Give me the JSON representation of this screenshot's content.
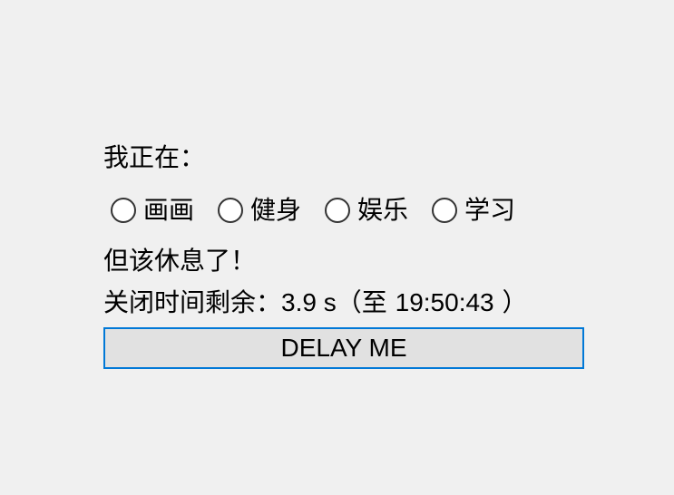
{
  "status_label": "我正在：",
  "activities": [
    {
      "label": "画画",
      "selected": false
    },
    {
      "label": "健身",
      "selected": false
    },
    {
      "label": "娱乐",
      "selected": false
    },
    {
      "label": "学习",
      "selected": false
    }
  ],
  "rest_message": "但该休息了！",
  "countdown": {
    "prefix": "关闭时间剩余：",
    "remaining": "3.9 s",
    "until_open": "（至 ",
    "until_time": "19:50:43",
    "until_close": " ）"
  },
  "delay_button_label": "DELAY ME",
  "colors": {
    "background": "#f0f0f0",
    "button_face": "#e1e1e1",
    "button_focus_border": "#0078d7"
  }
}
